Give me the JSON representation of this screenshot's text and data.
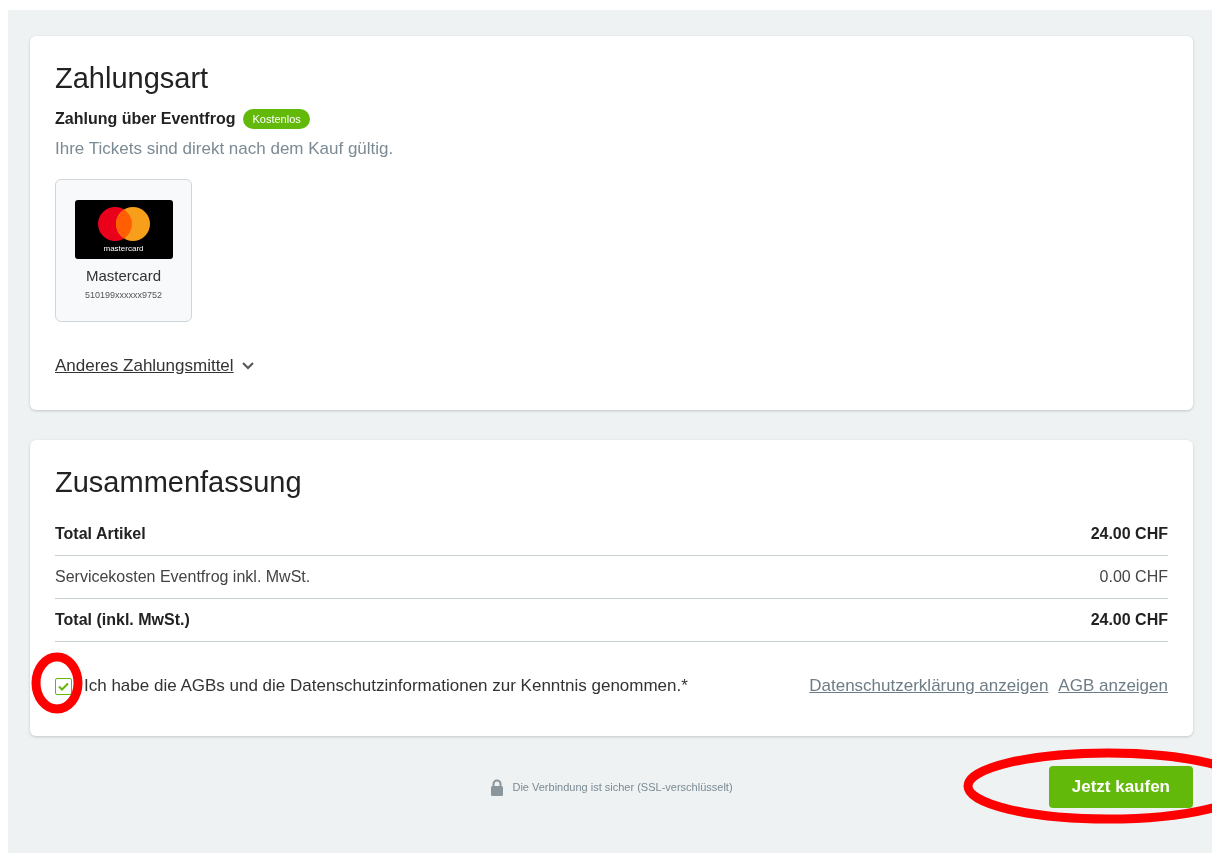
{
  "payment": {
    "title": "Zahlungsart",
    "method_label": "Zahlung über Eventfrog",
    "badge": "Kostenlos",
    "note": "Ihre Tickets sind direkt nach dem Kauf gültig.",
    "cards": [
      {
        "logo_text": "mastercard",
        "name": "Mastercard",
        "number": "510199xxxxxx9752",
        "selected": false
      }
    ],
    "other_link": "Anderes Zahlungsmittel"
  },
  "summary": {
    "title": "Zusammenfassung",
    "rows": [
      {
        "label": "Total Artikel",
        "value": "24.00 CHF",
        "bold": true
      },
      {
        "label": "Servicekosten Eventfrog inkl. MwSt.",
        "value": "0.00 CHF",
        "bold": false
      },
      {
        "label": "Total (inkl. MwSt.)",
        "value": "24.00 CHF",
        "bold": true
      }
    ],
    "agree": {
      "label": "Ich habe die AGBs und die Datenschutzinformationen zur Kenntnis genommen.*",
      "checked": true
    },
    "links": [
      "Datenschutzerklärung anzeigen",
      "AGB anzeigen"
    ]
  },
  "footer": {
    "secure_note": "Die Verbindung ist sicher (SSL-verschlüsselt)",
    "buy_button": "Jetzt kaufen"
  },
  "highlights": {
    "agree_checkbox": true,
    "buy_button": true
  }
}
